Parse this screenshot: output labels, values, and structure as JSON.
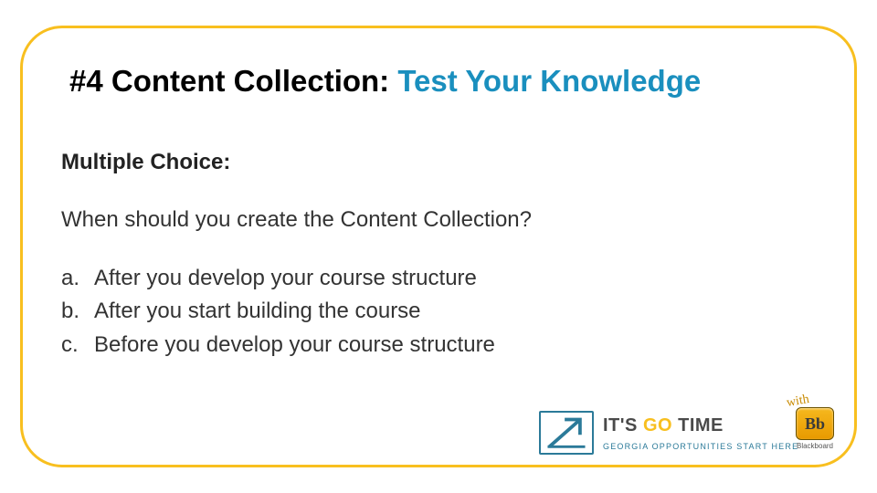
{
  "title": {
    "prefix": "#4 Content Collection: ",
    "accent": "Test Your Knowledge"
  },
  "subhead": "Multiple Choice:",
  "question": "When should you create the Content Collection?",
  "options": [
    {
      "letter": "a.",
      "text": "After you develop your course structure"
    },
    {
      "letter": "b.",
      "text": "After you start building the course"
    },
    {
      "letter": "c.",
      "text": "Before you develop your course structure"
    }
  ],
  "footer": {
    "its": "IT'S ",
    "go": "GO ",
    "time": "TIME",
    "subline": "GEORGIA OPPORTUNITIES START HERE",
    "with": "with",
    "bb_logo": "Bb",
    "bb_caption": "Blackboard"
  },
  "colors": {
    "frame": "#f8bf1f",
    "accent": "#1a8fbe",
    "brand_teal": "#2b7a99"
  }
}
